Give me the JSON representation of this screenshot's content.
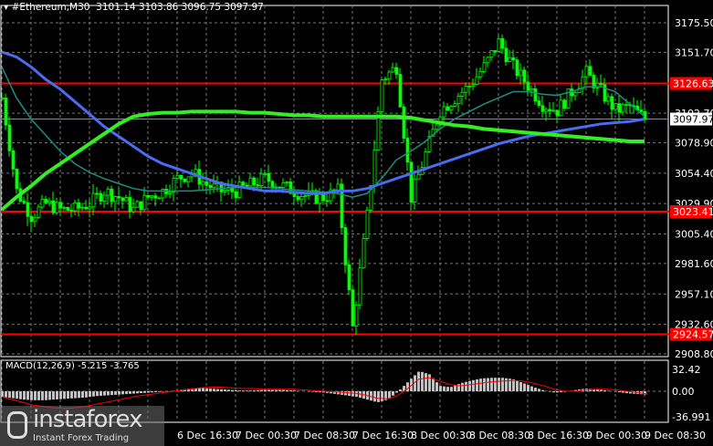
{
  "header": {
    "symbol": "#Ethereum,M30",
    "ohlc": "3101.14 3103.86 3096.75 3097.97"
  },
  "macd_label": "MACD(12,26,9) -5.215 -3.765",
  "logo": {
    "name": "instaforex",
    "tagline": "Instant Forex Trading"
  },
  "colors": {
    "up": "#00ff00",
    "down": "#00ff00",
    "ma_blue": "#4a6cf0",
    "ma_teal": "#1a8f80",
    "ma_green": "#33ee22",
    "level": "#ff0000",
    "hist": "#c0c0c0",
    "signal": "#ff0000"
  },
  "chart_data": {
    "type": "line",
    "title": "#Ethereum,M30",
    "ylim": [
      2908.8,
      3175.5
    ],
    "yticks": [
      "3175.50",
      "3151.70",
      "3102.70",
      "3078.90",
      "3054.40",
      "3029.90",
      "3005.40",
      "2981.60",
      "2957.10",
      "2932.60",
      "2908.80"
    ],
    "xticks": [
      "6 Dec 16:30",
      "7 Dec 00:30",
      "7 Dec 08:30",
      "7 Dec 16:30",
      "8 Dec 00:30",
      "8 Dec 08:30",
      "8 Dec 16:30",
      "9 Dec 00:30",
      "9 Dec 08:30"
    ],
    "bars_per_point": 4,
    "close_path": [
      3115,
      3040,
      3020,
      3030,
      3025,
      3025,
      3030,
      3040,
      3035,
      3025,
      3035,
      3040,
      3050,
      3055,
      3045,
      3040,
      3040,
      3045,
      3050,
      3045,
      3040,
      3035,
      3035,
      3040,
      2930,
      3020,
      3130,
      3140,
      3035,
      3070,
      3105,
      3115,
      3125,
      3140,
      3160,
      3140,
      3125,
      3110,
      3105,
      3120,
      3135,
      3120,
      3105,
      3108,
      3098
    ],
    "ma_blue": [
      3152,
      3148,
      3140,
      3130,
      3122,
      3112,
      3102,
      3092,
      3084,
      3076,
      3068,
      3062,
      3058,
      3054,
      3050,
      3046,
      3044,
      3042,
      3040,
      3040,
      3039,
      3038,
      3038,
      3040,
      3040,
      3042,
      3046,
      3050,
      3054,
      3058,
      3062,
      3066,
      3070,
      3074,
      3078,
      3081,
      3084,
      3086,
      3088,
      3090,
      3092,
      3094,
      3095,
      3096,
      3098
    ],
    "ma_teal": [
      3140,
      3115,
      3098,
      3085,
      3072,
      3062,
      3055,
      3050,
      3046,
      3042,
      3040,
      3040,
      3040,
      3040,
      3041,
      3042,
      3043,
      3043,
      3043,
      3042,
      3041,
      3040,
      3039,
      3038,
      3035,
      3038,
      3050,
      3065,
      3072,
      3080,
      3090,
      3098,
      3104,
      3110,
      3115,
      3120,
      3120,
      3118,
      3117,
      3120,
      3124,
      3124,
      3120,
      3110,
      3100
    ],
    "ma_green": [
      3025,
      3035,
      3044,
      3054,
      3062,
      3070,
      3078,
      3086,
      3094,
      3100,
      3102,
      3103,
      3103,
      3104,
      3104,
      3104,
      3104,
      3103,
      3103,
      3102,
      3101,
      3101,
      3100,
      3100,
      3100,
      3100,
      3100,
      3100,
      3099,
      3097,
      3095,
      3093,
      3092,
      3090,
      3089,
      3088,
      3087,
      3086,
      3085,
      3084,
      3083,
      3082,
      3081,
      3080,
      3080
    ],
    "levels": [
      {
        "label": "3126.63",
        "value": 3126.63
      },
      {
        "label": "3023.41",
        "value": 3023.41
      },
      {
        "label": "2924.57",
        "value": 2924.57
      }
    ],
    "current": {
      "label": "3097.97",
      "value": 3097.97
    },
    "macd": {
      "ylim": [
        -36.991,
        32.42
      ],
      "yticks": [
        "32.42",
        "0.00",
        "-36.991"
      ],
      "hist": [
        -8,
        -10,
        -12,
        -13,
        -13,
        -12,
        -11,
        -10,
        -9,
        -7,
        -6,
        -5,
        -4,
        -3,
        -2,
        -1,
        0,
        2,
        4,
        5,
        4,
        3,
        2,
        1,
        1,
        2,
        2,
        2,
        1,
        0,
        -1,
        -2,
        -4,
        -6,
        -8,
        -12,
        -16,
        -12,
        0,
        15,
        30,
        25,
        8,
        6,
        12,
        16,
        19,
        20,
        20,
        18,
        12,
        6,
        1,
        -2,
        -1,
        2,
        4,
        3,
        1,
        -1,
        -3,
        -4,
        -5
      ],
      "signal": [
        -8,
        -12,
        -16,
        -20,
        -22,
        -24,
        -25,
        -24,
        -22,
        -19,
        -16,
        -13,
        -10,
        -7,
        -5,
        -3,
        -1,
        1,
        3,
        5,
        6,
        6,
        5,
        4,
        4,
        3,
        3,
        3,
        3,
        2,
        1,
        0,
        -1,
        -2,
        -3,
        -6,
        -10,
        -11,
        -6,
        5,
        18,
        20,
        15,
        10,
        8,
        10,
        12,
        14,
        15,
        16,
        15,
        12,
        8,
        3,
        0,
        0,
        2,
        3,
        3,
        2,
        0,
        -2,
        -4
      ]
    }
  }
}
